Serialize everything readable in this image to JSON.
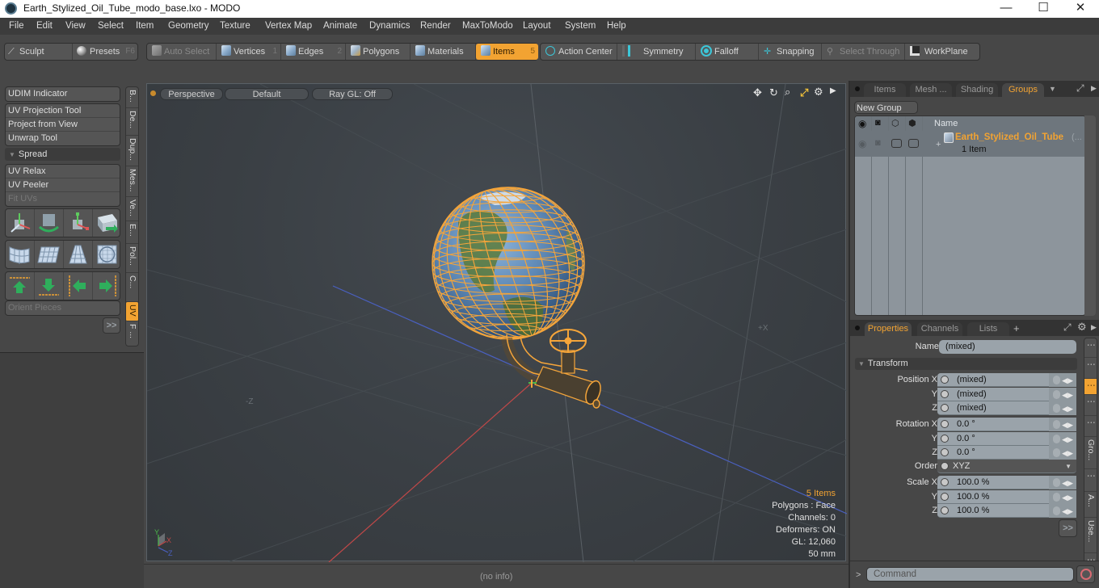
{
  "window": {
    "title": "Earth_Stylized_Oil_Tube_modo_base.lxo - MODO",
    "minimize": "—",
    "maximize": "☐",
    "close": "✕"
  },
  "menu": [
    "File",
    "Edit",
    "View",
    "Select",
    "Item",
    "Geometry",
    "Texture",
    "Vertex Map",
    "Animate",
    "Dynamics",
    "Render",
    "MaxToModo",
    "Layout",
    "System",
    "Help"
  ],
  "toolbar": {
    "sculpt": "Sculpt",
    "presets": "Presets",
    "presets_key": "F6",
    "auto_select": "Auto Select",
    "vertices": "Vertices",
    "vertices_key": "1",
    "edges": "Edges",
    "edges_key": "2",
    "polygons": "Polygons",
    "materials": "Materials",
    "items": "Items",
    "items_key": "5",
    "action_center": "Action Center",
    "symmetry": "Symmetry",
    "falloff": "Falloff",
    "snapping": "Snapping",
    "select_through": "Select Through",
    "workplane": "WorkPlane"
  },
  "left_panel": {
    "udim": "UDIM Indicator",
    "tools1": [
      "UV Projection Tool",
      "Project from View",
      "Unwrap Tool"
    ],
    "spread_header": "Spread",
    "tools2": [
      "UV Relax",
      "UV Peeler",
      "Fit UVs"
    ],
    "orient_pieces": "Orient Pieces",
    "expand": ">>",
    "icon_rows": [
      [
        "move-uv-icon",
        "rotate-uv-icon",
        "scale-uv-icon",
        "transform-uv-icon"
      ],
      [
        "uv-wrap-icon",
        "uv-plane-icon",
        "uv-taper-icon",
        "uv-sphere-icon"
      ],
      [
        "align-top-icon",
        "align-bottom-icon",
        "align-left-icon",
        "align-right-icon"
      ]
    ],
    "vertical_tabs": [
      "B...",
      "De...",
      "Dup...",
      "Mes...",
      "Ve...",
      "E...",
      "Pol...",
      "C...",
      "UV",
      "F ..."
    ],
    "active_tab": "UV"
  },
  "viewport": {
    "view": "Perspective",
    "shading": "Default",
    "raygl": "Ray GL: Off",
    "info": {
      "items": "5 Items",
      "polygons": "Polygons : Face",
      "channels": "Channels: 0",
      "deformers": "Deformers: ON",
      "gl": "GL: 12,060",
      "scale": "50 mm"
    },
    "axis_labels": {
      "x": "X",
      "y": "Y",
      "z": "Z",
      "neg_z": "-Z",
      "pos_x": "+X"
    }
  },
  "status": {
    "info": "(no info)"
  },
  "right_panel": {
    "top_tabs": [
      "Items",
      "Mesh ...",
      "Shading",
      "Groups"
    ],
    "active_top_tab": "Groups",
    "new_group": "New Group",
    "table_header": "Name",
    "group": {
      "name": "Earth_Stylized_Oil_Tube",
      "suffix": "(...",
      "count": "1 Item"
    },
    "bottom_tabs": [
      "Properties",
      "Channels",
      "Lists"
    ],
    "active_bottom_tab": "Properties",
    "add_tab": "+",
    "properties": {
      "name_label": "Name",
      "name_value": "(mixed)",
      "transform_header": "Transform",
      "position": {
        "label": "Position X",
        "x": "(mixed)",
        "y": "(mixed)",
        "z": "(mixed)"
      },
      "rotation": {
        "label": "Rotation X",
        "x": "0.0 °",
        "y": "0.0 °",
        "z": "0.0 °"
      },
      "order": {
        "label": "Order",
        "value": "XYZ"
      },
      "scale": {
        "label": "Scale X",
        "x": "100.0 %",
        "y": "100.0 %",
        "z": "100.0 %"
      },
      "y_label": "Y",
      "z_label": "Z"
    },
    "vertical_tabs": [
      "⋮",
      "⋮",
      "⋮",
      "⋮",
      "⋮",
      "Gro...",
      "⋮",
      "A...",
      "Use...",
      "⋮"
    ],
    "expand": ">>",
    "command_prompt": ">",
    "command_placeholder": "Command"
  },
  "colors": {
    "accent": "#f2a332",
    "panel": "#474747",
    "viewport_bg": "#3a3f44",
    "wireframe": "#f5a53a",
    "x_axis": "#c94a4a",
    "z_axis": "#4a62c9"
  }
}
